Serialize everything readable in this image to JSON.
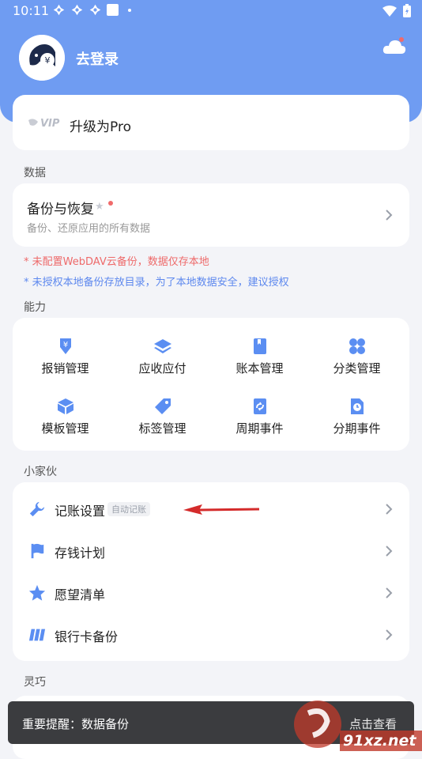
{
  "status_bar": {
    "time": "10:11"
  },
  "header": {
    "login_label": "去登录",
    "brand_color": "#6f9cf2"
  },
  "pro": {
    "badge_text": "VIP",
    "label": "升级为Pro"
  },
  "sections": {
    "data": "数据",
    "abilities": "能力",
    "helpers": "小家伙",
    "lingqiao": "灵巧"
  },
  "backup": {
    "title": "备份与恢复",
    "subtitle": "备份、还原应用的所有数据",
    "warning_webdav": "* 未配置WebDAV云备份，数据仅存本地",
    "warning_auth": "* 未授权本地备份存放目录，为了本地数据安全，建议授权"
  },
  "abilities": [
    {
      "label": "报销管理",
      "icon": "reimburse-icon"
    },
    {
      "label": "应收应付",
      "icon": "layers-icon"
    },
    {
      "label": "账本管理",
      "icon": "book-icon"
    },
    {
      "label": "分类管理",
      "icon": "category-grid-icon"
    },
    {
      "label": "模板管理",
      "icon": "cube-icon"
    },
    {
      "label": "标签管理",
      "icon": "tag-icon"
    },
    {
      "label": "周期事件",
      "icon": "cycle-doc-icon"
    },
    {
      "label": "分期事件",
      "icon": "clock-doc-icon"
    }
  ],
  "helpers": [
    {
      "label": "记账设置",
      "badge": "自动记账",
      "icon": "wrench-icon"
    },
    {
      "label": "存钱计划",
      "icon": "flag-icon"
    },
    {
      "label": "愿望清单",
      "icon": "star-icon"
    },
    {
      "label": "银行卡备份",
      "icon": "bank-card-icon"
    }
  ],
  "toast": {
    "message": "重要提醒：数据备份",
    "action": "点击查看"
  },
  "watermark": {
    "text": "91xz.net"
  },
  "colors": {
    "accent": "#6f9cf2",
    "warn_red": "#ee6a6a",
    "warn_blue": "#5d88ee",
    "arrow_red": "#d42b2b"
  }
}
